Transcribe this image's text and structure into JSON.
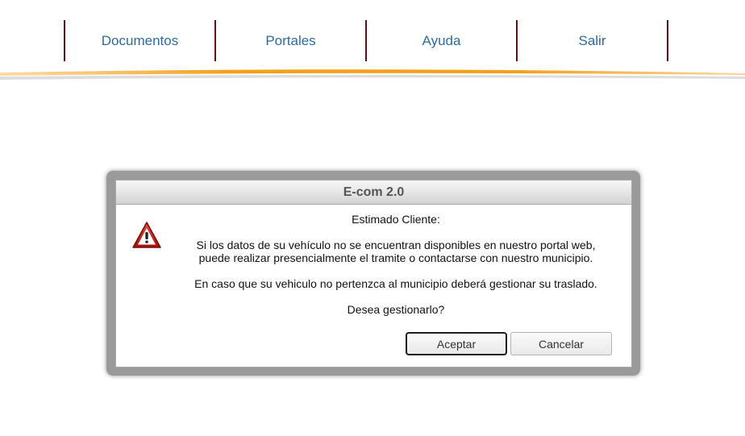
{
  "nav": {
    "items": [
      {
        "label": "Documentos"
      },
      {
        "label": "Portales"
      },
      {
        "label": "Ayuda"
      },
      {
        "label": "Salir"
      }
    ]
  },
  "dialog": {
    "title": "E-com 2.0",
    "greeting": "Estimado Cliente:",
    "line1": "Si los datos de su vehículo no se encuentran disponibles en nuestro portal web,",
    "line2": "puede realizar presencialmente el tramite o contactarse con nuestro municipio.",
    "line3": "En caso que su vehiculo no pertenzca al municipio deberá gestionar su traslado.",
    "question": "Desea gestionarlo?",
    "accept_label": "Aceptar",
    "cancel_label": "Cancelar",
    "icon": "warning-icon"
  },
  "colors": {
    "nav_text": "#2e6b9c",
    "nav_divider": "#5e0f14",
    "accent_orange": "#f5a623",
    "dialog_frame": "#9a9a9a"
  }
}
